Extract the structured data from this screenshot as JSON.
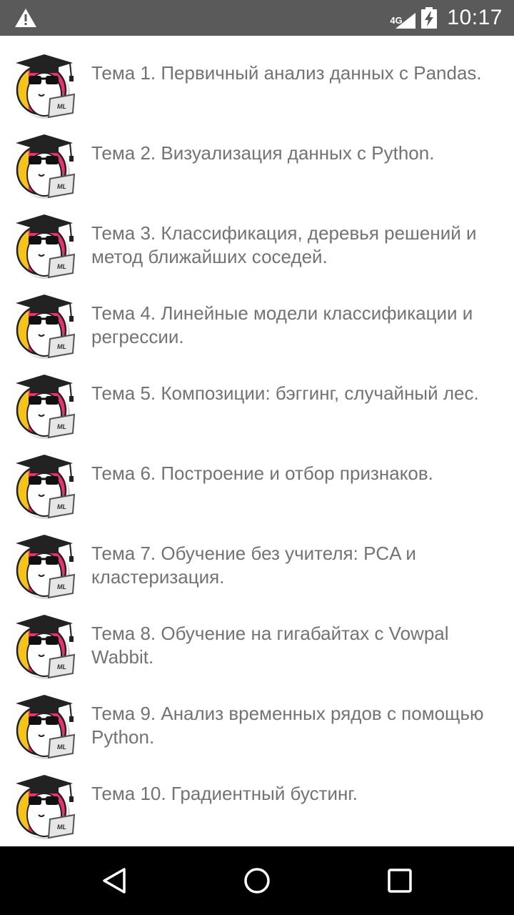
{
  "status_bar": {
    "warning_icon": "warning-icon",
    "network_type": "4G",
    "signal_icon": "cell-signal-icon",
    "battery_icon": "battery-charging-icon",
    "time": "10:17"
  },
  "topics": [
    {
      "title": "Тема 1. Первичный анализ данных с Pandas.",
      "icon": "ml-mascot-icon"
    },
    {
      "title": "Тема 2. Визуализация данных с Python.",
      "icon": "ml-mascot-icon"
    },
    {
      "title": "Тема 3. Классификация, деревья решений и метод ближайших соседей.",
      "icon": "ml-mascot-icon"
    },
    {
      "title": "Тема 4. Линейные модели классификации и регрессии.",
      "icon": "ml-mascot-icon"
    },
    {
      "title": "Тема 5. Композиции: бэггинг, случайный лес.",
      "icon": "ml-mascot-icon"
    },
    {
      "title": "Тема 6. Построение и отбор признаков.",
      "icon": "ml-mascot-icon"
    },
    {
      "title": "Тема 7. Обучение без учителя: PCA и кластеризация.",
      "icon": "ml-mascot-icon"
    },
    {
      "title": "Тема 8. Обучение на гигабайтах с Vowpal Wabbit.",
      "icon": "ml-mascot-icon"
    },
    {
      "title": "Тема 9. Анализ временных рядов с помощью Python.",
      "icon": "ml-mascot-icon"
    },
    {
      "title": "Тема 10. Градиентный бустинг.",
      "icon": "ml-mascot-icon"
    }
  ],
  "avatar_label": "ML",
  "nav_bar": {
    "back_icon": "back-triangle-icon",
    "home_icon": "home-circle-icon",
    "recents_icon": "recents-square-icon"
  },
  "colors": {
    "status_bar": "#5a5a5a",
    "nav_bar": "#000000",
    "text": "#737373",
    "avatar_pink": "#e8336d",
    "avatar_yellow": "#f6c417"
  }
}
